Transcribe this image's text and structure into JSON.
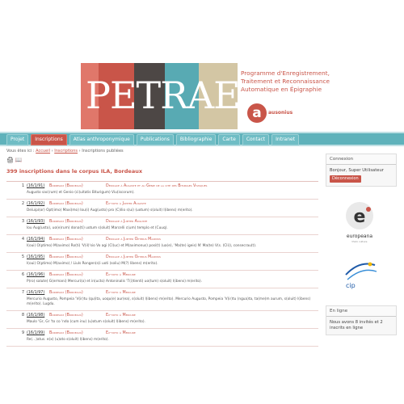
{
  "banner": {
    "logo": "PETRAE",
    "tagline": "Programme d'Enregistrement, Traitement et Reconnaissance Automatique en Épigraphie",
    "ausonius_letter": "a",
    "ausonius_name": "ausonius"
  },
  "nav": {
    "tabs": [
      "Projet",
      "Inscriptions",
      "Atlas anthroponymique",
      "Publications",
      "Bibliographie",
      "Carte",
      "Contact",
      "Intranet"
    ],
    "active_index": 1
  },
  "breadcrumb": {
    "prefix": "Vous êtes ici :",
    "items": [
      "Accueil",
      "Inscriptions",
      "Inscriptions publiées"
    ]
  },
  "tools": {
    "print_icon": "🖨",
    "book_icon": "📖"
  },
  "main": {
    "page_title": "399 inscriptions dans le corpus ILA, Bordeaux",
    "rows": [
      {
        "num": "1",
        "ref": "(16/1/91)",
        "place": "Bordeaux (Bordeaux)",
        "title": "Dédicace à Auguste et au Génie de la cité des Bituriges Vivisques",
        "text": "Augusto sac(rum) et Genio (ci)uitatis Biturigum) Viu(iscorum)."
      },
      {
        "num": "2",
        "ref": "(16/1/92)",
        "place": "Bordeaux (Bordeaux)",
        "title": "Ex-voto à Jupiter Auguste",
        "text": "Deïuipi(or) Opt(imo) Maxi(mo) Iou(i) Aug(usto) pro (C)ilio s(ui) (uotum) s(oluit) l(ibens) m(erito)."
      },
      {
        "num": "3",
        "ref": "(16/1/93)",
        "place": "Bordeaux (Bordeaux)",
        "title": "Dédicace à Jupiter Auguste",
        "text": "Iou Aug(usto), uo(e)rum) dona(ti) uotum s(oluit) Marcelli c(um) templo et (Cuuq)."
      },
      {
        "num": "4",
        "ref": "(16/1/94)",
        "place": "Bordeaux (Bordeaux)",
        "title": "Dédicace à Jupiter Optimus Maximus",
        "text": "I(oui) O(ptimo) M(aximo) Ro(ti) 'V(il)'sio Vo agi (Cl)uc) et M(aximonus) posi(t) (ua(e), 'Ma(te) igeis) N' Ma(te) V(s. (Cli)), consecrau(t)."
      },
      {
        "num": "5",
        "ref": "(16/1/95)",
        "place": "Bordeaux (Bordeaux)",
        "title": "Dédicace à Jupiter Optimus Maximus",
        "text": "I(oui) O(ptimo) M(aximo) / Liuls Rongen(s)i uoti (soliu) M(?) libens) m(erito)."
      },
      {
        "num": "6",
        "ref": "(16/1/96)",
        "place": "Bordeaux (Bordeaux)",
        "title": "Ex-voto à Mercure",
        "text": "P(ro) salute) G(ermani) Mercuri(o) et in(ucto) Antoninalis 'T(i)tienti) uo(tum) s(oluit) l(ibens) m(erito)."
      },
      {
        "num": "7",
        "ref": "(16/1/97)",
        "place": "Bordeaux (Bordeaux)",
        "title": "Ex-voto à Mercure",
        "text": "Mercurio Augusto, Pompeia 'V(ir)tu (qu)ita, uoqu(e) aur(ea), s(oluit) l(ibens) m(erito). Mercurio Augusto, Pompeia 'V(ir)tu (ngua)ta, ta(me)m aurum, s(oluit) l(ibens) m(erito). Lugdu."
      },
      {
        "num": "8",
        "ref": "(16/1/98)",
        "place": "Bordeaux (Bordeaux)",
        "title": "Ex-voto à Mercure",
        "text": "Maulo 'Gr, Gr 'to co 'ndo (cum inu) (u)otum s(oluit) l(ibens) m(erito)."
      },
      {
        "num": "9",
        "ref": "(16/1/99)",
        "place": "Bordeaux (Bordeaux)",
        "title": "Ex-voto à Mercure",
        "text": "Re(...)atus. e(x) (u)oto s(oluit) l(ibens) m(erito)."
      }
    ]
  },
  "sidebar": {
    "connexion": {
      "heading": "Connexion",
      "greeting": "Bonjour, Super Utilisateur",
      "logout": "Déconnexion"
    },
    "europeana": {
      "label": "europeana",
      "sub": "think culture"
    },
    "cip": {
      "label": "cip"
    },
    "online": {
      "heading": "En ligne",
      "text": "Nous avons 8 invités et 2 inscrits en ligne"
    }
  },
  "colors": {
    "accent": "#c95549",
    "nav": "#5fb2bb"
  }
}
